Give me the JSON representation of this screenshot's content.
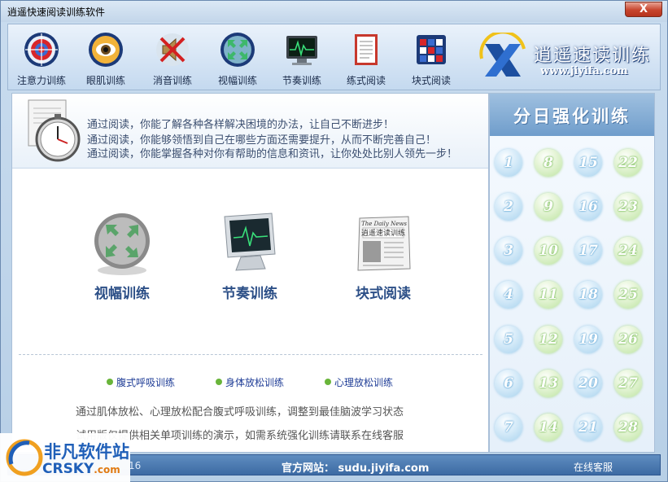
{
  "window": {
    "title": "逍遥快速阅读训练软件",
    "close_label": "X"
  },
  "toolbar": {
    "items": [
      {
        "label": "注意力训练",
        "icon": "target-icon"
      },
      {
        "label": "眼肌训练",
        "icon": "eye-icon"
      },
      {
        "label": "消音训练",
        "icon": "mute-speaker-icon"
      },
      {
        "label": "视幅训练",
        "icon": "expand-arrows-icon"
      },
      {
        "label": "节奏训练",
        "icon": "monitor-wave-icon"
      },
      {
        "label": "练式阅读",
        "icon": "notepad-icon"
      },
      {
        "label": "块式阅读",
        "icon": "block-grid-icon"
      }
    ]
  },
  "brand": {
    "name": "逍遥速读训练",
    "url": "www.jiyifa.com"
  },
  "intro": {
    "lines": [
      "通过阅读，你能了解各种各样解决困境的办法，让自己不断进步！",
      "通过阅读，你能够领悟到自己在哪些方面还需要提升，从而不断完善自己！",
      "通过阅读，你能掌握各种对你有帮助的信息和资讯，让你处处比别人领先一步！"
    ]
  },
  "features": [
    {
      "label": "视幅训练",
      "icon": "expand-arrows-icon"
    },
    {
      "label": "节奏训练",
      "icon": "monitor-wave-icon"
    },
    {
      "label": "块式阅读",
      "icon": "newspaper-icon",
      "paper_title": "The Daily News",
      "paper_text": "逍遥速读训练"
    }
  ],
  "relax_links": [
    "腹式呼吸训练",
    "身体放松训练",
    "心理放松训练"
  ],
  "description": [
    "通过肌体放松、心理放松配合腹式呼吸训练，调整到最佳脑波学习状态",
    "试用版仅提供相关单项训练的演示，如需系统强化训练请联系在线客服"
  ],
  "sidebar": {
    "title": "分日强化训练",
    "days": [
      "1",
      "2",
      "3",
      "4",
      "5",
      "6",
      "7",
      "8",
      "9",
      "10",
      "11",
      "12",
      "13",
      "14",
      "15",
      "16",
      "17",
      "18",
      "19",
      "20",
      "21",
      "22",
      "23",
      "24",
      "25",
      "26",
      "27",
      "28"
    ]
  },
  "status": {
    "left": "16",
    "site": "官方网站： sudu.jiyifa.com",
    "service": "在线客服"
  },
  "watermark": {
    "cn": "非凡软件站",
    "en": "CRSKY",
    "suffix": ".com"
  },
  "colors": {
    "accent": "#3c6aa3",
    "link": "#1e3c96",
    "bullet": "#69b53a"
  }
}
